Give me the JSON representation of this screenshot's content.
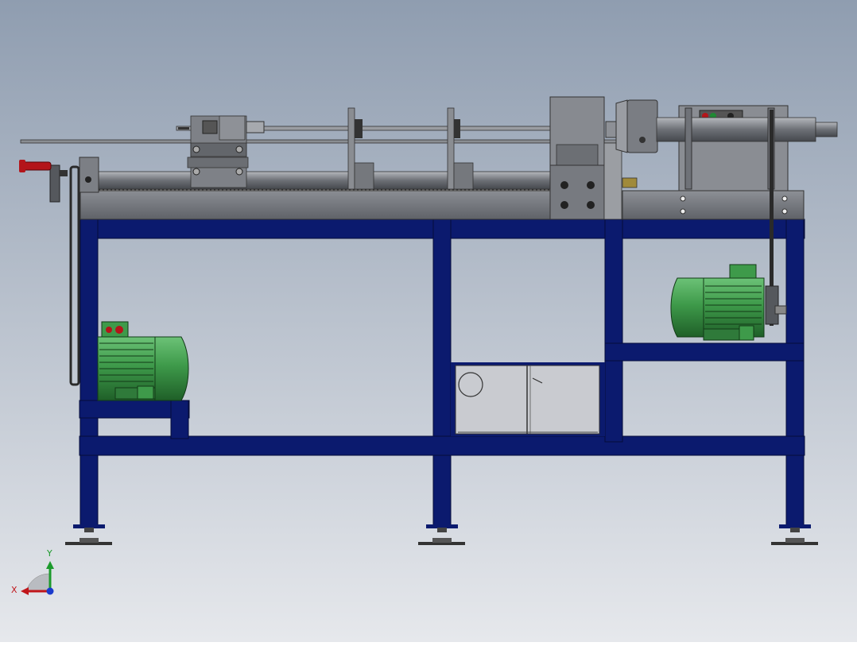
{
  "view": {
    "background_top": "#8f9db0",
    "background_bottom": "#e6e8ec"
  },
  "colors": {
    "frame": "#0b1a6e",
    "frame_edge": "#050c3a",
    "steel": "#7c7f85",
    "steel_dark": "#55585d",
    "steel_light": "#a7aaaf",
    "motor_green": "#3e9a4a",
    "motor_green_dark": "#1f5f28",
    "handle_red": "#b3151a",
    "brass": "#a08a3a",
    "enclosure": "#c9cbd0"
  },
  "triad": {
    "x_label": "X",
    "y_label": "Y",
    "x_color": "#c0161b",
    "y_color": "#1c9a2c",
    "z_color": "#1a3acc"
  },
  "components": {
    "frame": "welded-steel-frame",
    "bed": "machine-bed",
    "left_motor": "drive-motor",
    "right_motor": "spindle-motor",
    "chuck": "three-jaw-chuck",
    "control_box": "electrical-enclosure",
    "handwheel": "hand-crank"
  }
}
